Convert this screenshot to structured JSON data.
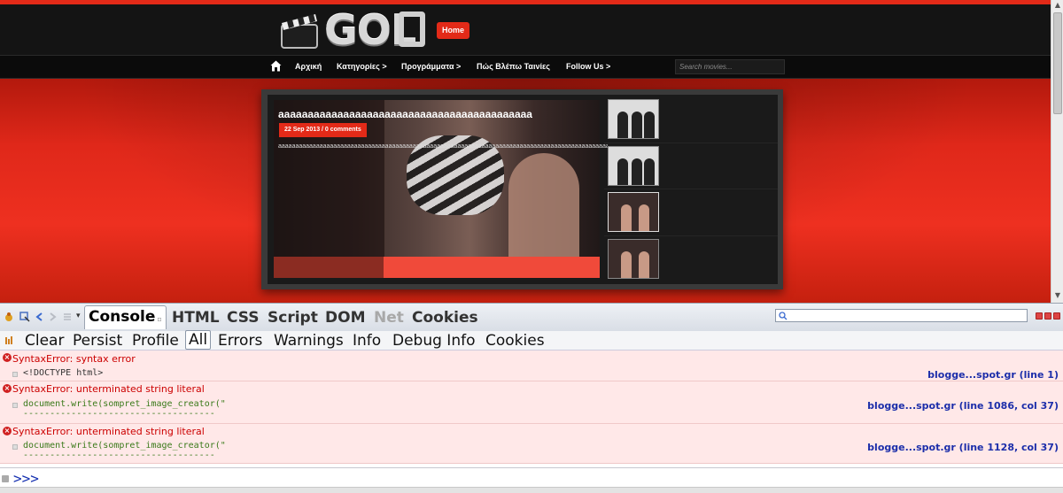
{
  "site": {
    "logo_text": "GOL",
    "home_button": "Home",
    "nav": [
      {
        "label": "Αρχική"
      },
      {
        "label": "Κατηγορίες >"
      },
      {
        "label": "Προγράμματα >"
      },
      {
        "label": "Πώς Βλέπω Ταινίες"
      },
      {
        "label": "Follow Us >"
      }
    ],
    "search_placeholder": "Search movies...",
    "slide": {
      "title": "aaaaaaaaaaaaaaaaaaaaaaaaaaaaaaaaaaaaaaaaaaa",
      "meta": "22 Sep 2013 / 0 comments",
      "excerpt": "aaaaaaaaaaaaaaaaaaaaaaaaaaaaaaaaaaaaaaaaaaaaaaaaaaaaaaaaaaaaaaaaaaaaaaaaaaaaaaaaaaaaaaaaaaaaaaaaaaaaaa"
    },
    "colors": {
      "accent": "#e32a18",
      "dark": "#141414"
    }
  },
  "firebug": {
    "tabs": [
      {
        "label": "Console"
      },
      {
        "label": "HTML"
      },
      {
        "label": "CSS"
      },
      {
        "label": "Script"
      },
      {
        "label": "DOM"
      },
      {
        "label": "Net"
      },
      {
        "label": "Cookies"
      }
    ],
    "filters": [
      {
        "label": "Clear"
      },
      {
        "label": "Persist"
      },
      {
        "label": "Profile"
      },
      {
        "label": "All"
      },
      {
        "label": "Errors"
      },
      {
        "label": "Warnings"
      },
      {
        "label": "Info"
      },
      {
        "label": "Debug Info"
      },
      {
        "label": "Cookies"
      }
    ],
    "errors": [
      {
        "message": "SyntaxError: syntax error",
        "code": "<!DOCTYPE html>",
        "dots": "",
        "source": "blogge...spot.gr (line 1)"
      },
      {
        "message": "SyntaxError: unterminated string literal",
        "code": "document.write(sompret_image_creator(\"",
        "dots": "------------------------------------",
        "source": "blogge...spot.gr (line 1086, col 37)"
      },
      {
        "message": "SyntaxError: unterminated string literal",
        "code": "document.write(sompret_image_creator(\"",
        "dots": "------------------------------------",
        "source": "blogge...spot.gr (line 1128, col 37)"
      }
    ],
    "prompt": ">>>"
  }
}
